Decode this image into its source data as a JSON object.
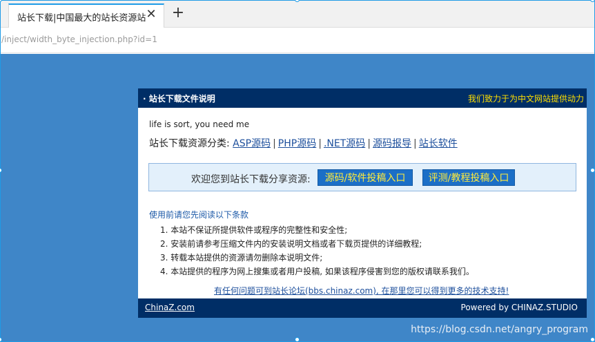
{
  "browser": {
    "tab_title": "站长下载|中国最大的站长资源站",
    "tab_close": "✕",
    "new_tab": "+",
    "url": "/inject/width_byte_injection.php?id=1"
  },
  "dialog": {
    "title": "· 站长下载文件说明",
    "slogan": "我们致力于为中文网站提供动力",
    "line1": "life is sort, you need me",
    "categories_label": "站长下载资源分类:",
    "categories": [
      "ASP源码",
      "PHP源码",
      ".NET源码",
      "源码报导",
      "站长软件"
    ],
    "separator": "|",
    "share_text": "欢迎您到站长下载分享资源:",
    "share_buttons": [
      "源码/软件投稿入口",
      "评测/教程投稿入口"
    ],
    "notice_title": "使用前请您先阅读以下条款",
    "rules": [
      "1. 本站不保证所提供软件或程序的完整性和安全性;",
      "2. 安装前请参考压缩文件内的安装说明文档或者下载页提供的详细教程;",
      "3. 转载本站提供的资源请勿删除本说明文件;",
      "4. 本站提供的程序为网上搜集或者用户投稿, 如果该程序侵害到您的版权请联系我们。"
    ],
    "forum_link": "有任何问题可到站长论坛(bbs.chinaz.com), 在那里您可以得到更多的技术支持!",
    "footer_left": "ChinaZ.com",
    "footer_right": "Powered by CHINAZ.STUDIO"
  },
  "watermark": "https://blog.csdn.net/angry_program",
  "colors": {
    "page_bg": "#3f86c8",
    "dialog_header": "#002e66",
    "slogan": "#ffde00",
    "link": "#1d4f9c",
    "button_bg": "#1c6fc7",
    "button_text": "#ffeb3b"
  }
}
